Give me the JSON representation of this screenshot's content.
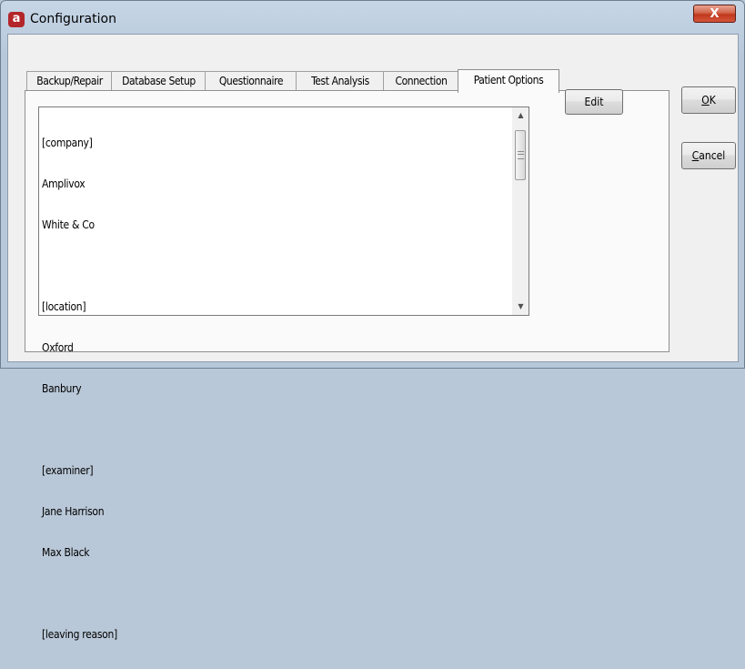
{
  "window": {
    "title": "Configuration",
    "app_icon_glyph": "a",
    "close_glyph": "X"
  },
  "tabs": [
    {
      "label": "Backup/Repair",
      "active": false
    },
    {
      "label": "Database Setup",
      "active": false
    },
    {
      "label": "Questionnaire",
      "active": false
    },
    {
      "label": "Test Analysis",
      "active": false
    },
    {
      "label": "Connection",
      "active": false
    },
    {
      "label": "Patient Options",
      "active": true
    }
  ],
  "patient_options": {
    "lines": [
      "[company]",
      "Amplivox",
      "White & Co",
      "",
      "[location]",
      "Oxford",
      "Banbury",
      "",
      "[examiner]",
      "Jane Harrison",
      "Max Black",
      "",
      "[leaving reason]"
    ],
    "edit_label": "Edit",
    "scroll_up_glyph": "▲",
    "scroll_down_glyph": "▼"
  },
  "buttons": {
    "ok_label": "OK",
    "cancel_label": "Cancel"
  },
  "colors": {
    "close_button": "#c1381c",
    "app_icon": "#b3262a"
  },
  "icons": [
    "app-icon",
    "close-icon",
    "scroll-up-icon",
    "scroll-down-icon"
  ]
}
